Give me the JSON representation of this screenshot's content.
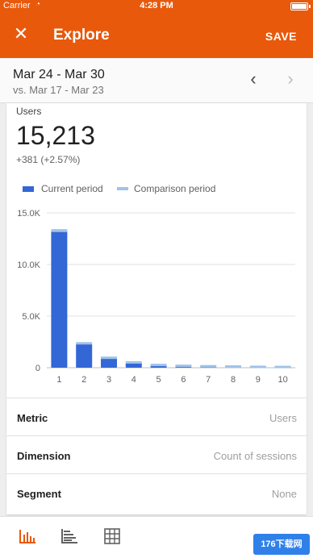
{
  "status_bar": {
    "carrier": "Carrier",
    "time": "4:28 PM"
  },
  "app_bar": {
    "close_icon": "close-icon",
    "title": "Explore",
    "save_label": "SAVE"
  },
  "date_bar": {
    "range": "Mar 24 - Mar 30",
    "compare": "vs. Mar 17 - Mar 23",
    "prev_icon": "chevron-left-icon",
    "next_icon": "chevron-right-icon"
  },
  "metric": {
    "label": "Users",
    "value": "15,213",
    "change": "+381 (+2.57%)"
  },
  "legend": {
    "current": "Current period",
    "comparison": "Comparison period"
  },
  "colors": {
    "accent": "#e8590c",
    "current": "#3367d6",
    "comparison": "#9fc3e8"
  },
  "chart_data": {
    "type": "bar",
    "categories": [
      "1",
      "2",
      "3",
      "4",
      "5",
      "6",
      "7",
      "8",
      "9",
      "10"
    ],
    "yticks": [
      "0",
      "5.0K",
      "10.0K",
      "15.0K"
    ],
    "ylim": [
      0,
      15000
    ],
    "series": [
      {
        "name": "Current period",
        "values": [
          13400,
          2300,
          900,
          450,
          250,
          180,
          150,
          120,
          100,
          90
        ]
      },
      {
        "name": "Comparison period",
        "values": [
          13300,
          2400,
          1000,
          550,
          300,
          220,
          180,
          150,
          120,
          110
        ]
      }
    ]
  },
  "rows": [
    {
      "label": "Metric",
      "value": "Users"
    },
    {
      "label": "Dimension",
      "value": "Count of sessions"
    },
    {
      "label": "Segment",
      "value": "None"
    }
  ],
  "bottom_tabs": [
    {
      "icon": "bar-chart-icon",
      "active": true
    },
    {
      "icon": "horizontal-bar-icon",
      "active": false
    },
    {
      "icon": "table-grid-icon",
      "active": false
    }
  ]
}
